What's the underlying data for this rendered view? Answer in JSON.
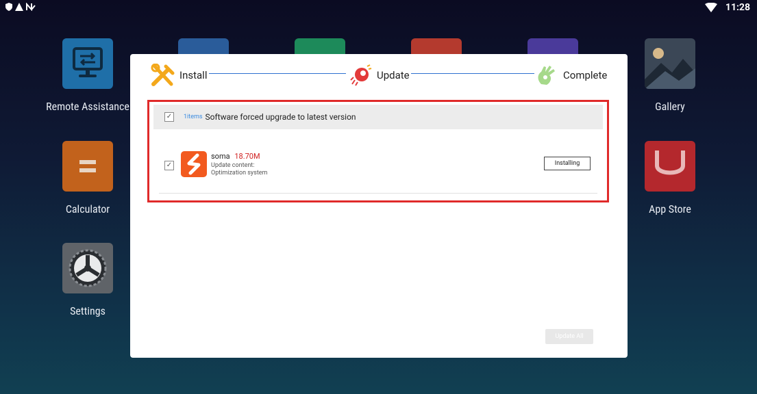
{
  "status_bar": {
    "time": "11:28"
  },
  "apps": [
    {
      "label": "Remote Assistance",
      "icon": "remote-desktop-icon"
    },
    {
      "label": "Calculator",
      "icon": "calculator-icon"
    },
    {
      "label": "Settings",
      "icon": "settings-gear-icon"
    },
    {
      "label": "Gallery",
      "icon": "gallery-icon"
    },
    {
      "label": "App Store",
      "icon": "app-store-icon"
    }
  ],
  "dialog": {
    "steps": [
      {
        "label": "Install",
        "icon": "tools-icon"
      },
      {
        "label": "Update",
        "icon": "rocket-icon"
      },
      {
        "label": "Complete",
        "icon": "ok-hand-icon"
      }
    ],
    "list": {
      "count": "1items",
      "header": "Software forced upgrade to latest version",
      "items": [
        {
          "name": "soma",
          "size": "18.70M",
          "update_label": "Update content:",
          "update_text": "Optimization system",
          "button": "Installing"
        }
      ]
    },
    "update_all": "Update All"
  },
  "colors": {
    "accent": "#2d6fd0",
    "highlight_border": "#e02a2a",
    "app_icon": "#f25a1f"
  }
}
